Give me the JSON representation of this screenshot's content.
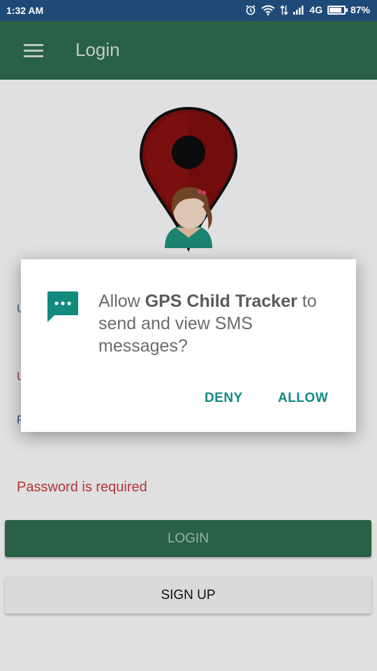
{
  "status_bar": {
    "time": "1:32 AM",
    "network": "4G",
    "battery": "87%",
    "battery_level": 0.87,
    "icons": [
      "alarm-icon",
      "wifi-icon",
      "data-arrows-icon",
      "signal-icon",
      "battery-icon"
    ]
  },
  "app_bar": {
    "title": "Login",
    "menu_icon": "hamburger-menu-icon"
  },
  "form": {
    "username_hint_fragment": "U",
    "username_error_fragment": "U",
    "password_hint_fragment": "P",
    "password_error": "Password is required"
  },
  "buttons": {
    "login": "LOGIN",
    "signup": "SIGN UP"
  },
  "dialog": {
    "icon": "sms-message-icon",
    "prefix": "Allow ",
    "app_name": "GPS Child Tracker",
    "suffix": " to send and view SMS messages?",
    "deny": "DENY",
    "allow": "ALLOW"
  },
  "colors": {
    "appbar": "#2c6a4a",
    "accent": "#138a84",
    "error": "#c53a3a",
    "pin_red": "#7a0e0e"
  }
}
